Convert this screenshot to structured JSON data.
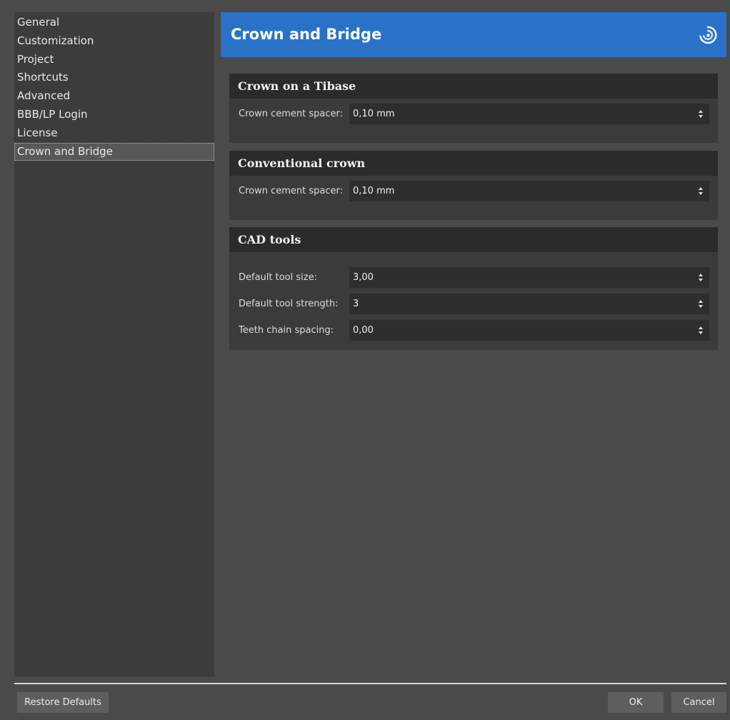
{
  "sidebar": {
    "items": [
      {
        "label": "General"
      },
      {
        "label": "Customization"
      },
      {
        "label": "Project"
      },
      {
        "label": "Shortcuts"
      },
      {
        "label": "Advanced"
      },
      {
        "label": "BBB/LP Login"
      },
      {
        "label": "License"
      },
      {
        "label": "Crown and Bridge",
        "selected": true
      }
    ]
  },
  "header": {
    "title": "Crown and Bridge",
    "logo_icon": "swirl-logo-icon",
    "color": "#2a72c8"
  },
  "groups": [
    {
      "title": "Crown on a Tibase",
      "fields": [
        {
          "label": "Crown cement spacer:",
          "value": "0,10 mm"
        }
      ]
    },
    {
      "title": "Conventional crown",
      "fields": [
        {
          "label": "Crown cement spacer:",
          "value": "0,10 mm"
        }
      ]
    },
    {
      "title": "CAD tools",
      "fields": [
        {
          "label": "Default tool size:",
          "value": "3,00"
        },
        {
          "label": "Default tool strength:",
          "value": "3"
        },
        {
          "label": "Teeth chain spacing:",
          "value": "0,00"
        }
      ]
    }
  ],
  "footer": {
    "restore_label": "Restore Defaults",
    "ok_label": "OK",
    "cancel_label": "Cancel"
  }
}
